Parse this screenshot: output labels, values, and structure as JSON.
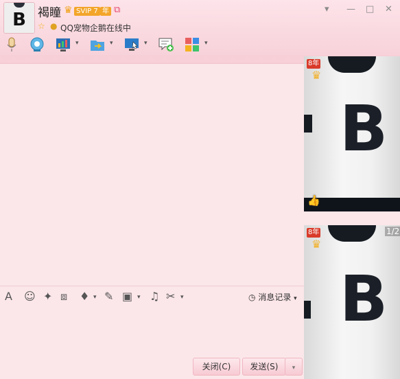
{
  "profile": {
    "name": "褐瞳",
    "vip_badge": "SVIP 7",
    "year_badge": "年",
    "status": "QQ宠物企鹅在线中"
  },
  "window_controls": {
    "menu": "▾",
    "minimize": "—",
    "maximize": "□",
    "close": "✕"
  },
  "toolbar": {
    "items": [
      {
        "name": "voice-call",
        "icon": "microphone-icon"
      },
      {
        "name": "video-call",
        "icon": "webcam-icon"
      },
      {
        "name": "remote-desktop",
        "icon": "chart-screen-icon"
      },
      {
        "name": "send-file",
        "icon": "folder-arrow-icon"
      },
      {
        "name": "screen-share",
        "icon": "monitor-cursor-icon"
      },
      {
        "name": "create-group",
        "icon": "chat-plus-icon"
      },
      {
        "name": "apps",
        "icon": "apps-grid-icon"
      }
    ]
  },
  "input_toolbar": {
    "history_label": "消息记录"
  },
  "buttons": {
    "close_label": "关闭(C)",
    "send_label": "发送(S)"
  },
  "side_panel": {
    "year_badge_top": "8年",
    "year_badge_bottom": "8年",
    "page": "1/2",
    "shirt_letter": "B"
  },
  "colors": {
    "header_bg": "#fde4ea",
    "chat_bg": "#fbe7ea",
    "button_bg": "#f7cad3",
    "accent": "#f3a52a"
  }
}
